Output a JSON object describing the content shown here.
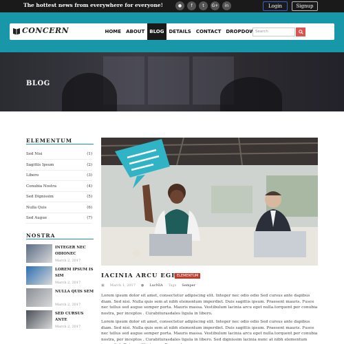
{
  "topbar": {
    "tagline": "The hottest news from everywhere for everyone!",
    "social_icons": [
      "rss-icon",
      "facebook-icon",
      "twitter-icon",
      "google-plus-icon",
      "linkedin-icon"
    ],
    "social_glyphs": [
      "●",
      "f",
      "t",
      "G+",
      "in"
    ],
    "login_label": "Login",
    "signup_label": "Signup"
  },
  "header": {
    "logo_text": "CONCERN",
    "nav": [
      {
        "label": "HOME",
        "active": false
      },
      {
        "label": "ABOUT",
        "active": false
      },
      {
        "label": "BLOG",
        "active": true
      },
      {
        "label": "DETAILS",
        "active": false
      },
      {
        "label": "CONTACT",
        "active": false
      },
      {
        "label": "DROPDOWN",
        "active": false,
        "caret": "▾"
      }
    ],
    "search_placeholder": "Search"
  },
  "banner": {
    "title": "BLOG"
  },
  "sidebar": {
    "categories_title": "ELEMENTUM",
    "categories": [
      {
        "label": "Sed Nisi",
        "count": "(1)"
      },
      {
        "label": "Sagittis Ipsum",
        "count": "(2)"
      },
      {
        "label": "Libero",
        "count": "(3)"
      },
      {
        "label": "Conubia Nostra",
        "count": "(4)"
      },
      {
        "label": "Sed Dignissim",
        "count": "(5)"
      },
      {
        "label": "Nulla Quis",
        "count": "(6)"
      },
      {
        "label": "Sed Augue",
        "count": "(7)"
      }
    ],
    "posts_title": "NOSTRA",
    "posts": [
      {
        "title": "INTEGER NEC ODIONEC",
        "date": "March 2, 2017"
      },
      {
        "title": "LOREM IPSUM IS SIM",
        "date": "March 2, 2017"
      },
      {
        "title": "NULLA QUIS SEM",
        "date": "March 2, 2017"
      },
      {
        "title": "SED CURSUS ANTE",
        "date": "March 2, 2017"
      }
    ]
  },
  "article": {
    "title": "IACINIA ARCU EGET",
    "badge": "ELEMENTUM",
    "meta_date": "March 1, 2017",
    "meta_author": "LucNIA",
    "meta_tags_label": "Tags",
    "meta_tag": "Semper",
    "paragraphs": [
      "Lorem ipsum dolor sit amet, consectetur adipiscing elit. Integer nec odio odio Sed cursus ante dapibus diam. Sed nisi. Nulla quis sem at nibh elementum imperdiet. Duis sagittis ipsum. Praesent mauris. Fusce nec tellus sed augue semper porta. Mauris massa. Vestibulum lacinia arcu eget nulla.torquent per conubia nostra, per inceptos . Curabiturasdales ligula in libero.",
      "Lorem ipsum dolor sit amet, consectetur adipiscing elit. Integer nec odio odio Sed cursus ante dapibus diam. Sed nisi. Nulla quis sem at nibh elementum imperdiet. Duis sagittis ipsum. Praesent mauris. Fusce nec tellus sed augue semper porta. Mauris massa. Vestibulum lacinia arcu eget nulla.torquent per conubia nostra, per inceptos . Curabiturasdales ligula in libero. Sed dignissim lacinia nunc at nibh elementum imperdiet. Duis sagittis ipsum. Praesent"
    ]
  },
  "colors": {
    "header_teal": "#1797a8",
    "topbar": "#1a1a1a",
    "badge_red": "#c0392b",
    "search_button": "#d9534f",
    "speech_bubble": "#2fb3c5"
  }
}
